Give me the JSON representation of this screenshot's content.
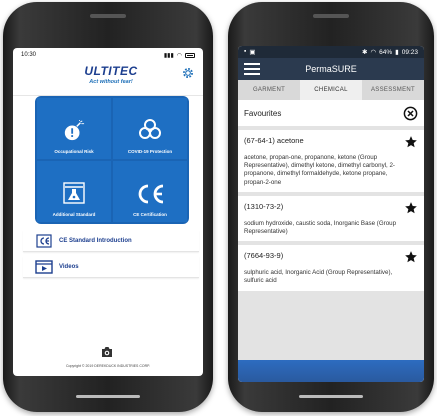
{
  "left_app": {
    "status": {
      "time": "10:30"
    },
    "logo": {
      "brand": "ULTITEC",
      "tagline": "Act without fear!"
    },
    "tiles": [
      {
        "label": "Occupational Risk",
        "icon": "bomb-icon"
      },
      {
        "label": "COVID-19 Protection",
        "icon": "biohazard-icon"
      },
      {
        "label": "Additional Standard",
        "icon": "flask-icon"
      },
      {
        "label": "CE Certification",
        "icon": "ce-mark-icon"
      }
    ],
    "menu": [
      {
        "label": "CE Standard Introduction",
        "icon": "ce-book-icon"
      },
      {
        "label": "Videos",
        "icon": "video-icon"
      }
    ],
    "copyright": "Copyright © 2019 DEREKDUCK INDUSTRIES CORP."
  },
  "right_app": {
    "status": {
      "battery": "64%",
      "time": "09:23"
    },
    "title": "PermaSURE",
    "tabs": [
      "GARMENT",
      "CHEMICAL",
      "ASSESSMENT"
    ],
    "active_tab": "CHEMICAL",
    "favourites_label": "Favourites",
    "chemicals": [
      {
        "cas": "(67-64-1) acetone",
        "names": "acetone, propan-one, propanone, ketone (Group Representative), dimethyl ketone, dimethyl carbonyl, 2-propanone, dimethyl formaldehyde, ketone propane, propan-2-one"
      },
      {
        "cas": "(1310-73-2)",
        "names": "sodium hydroxide, caustic soda, Inorganic Base (Group Representative)"
      },
      {
        "cas": "(7664-93-9)",
        "names": "sulphuric acid, Inorganic Acid (Group Representative), sulfuric acid"
      }
    ]
  },
  "colors": {
    "tile_blue": "#1e6fc3",
    "brand_navy": "#1d3f8f",
    "appbar": "#2b3a4f"
  }
}
